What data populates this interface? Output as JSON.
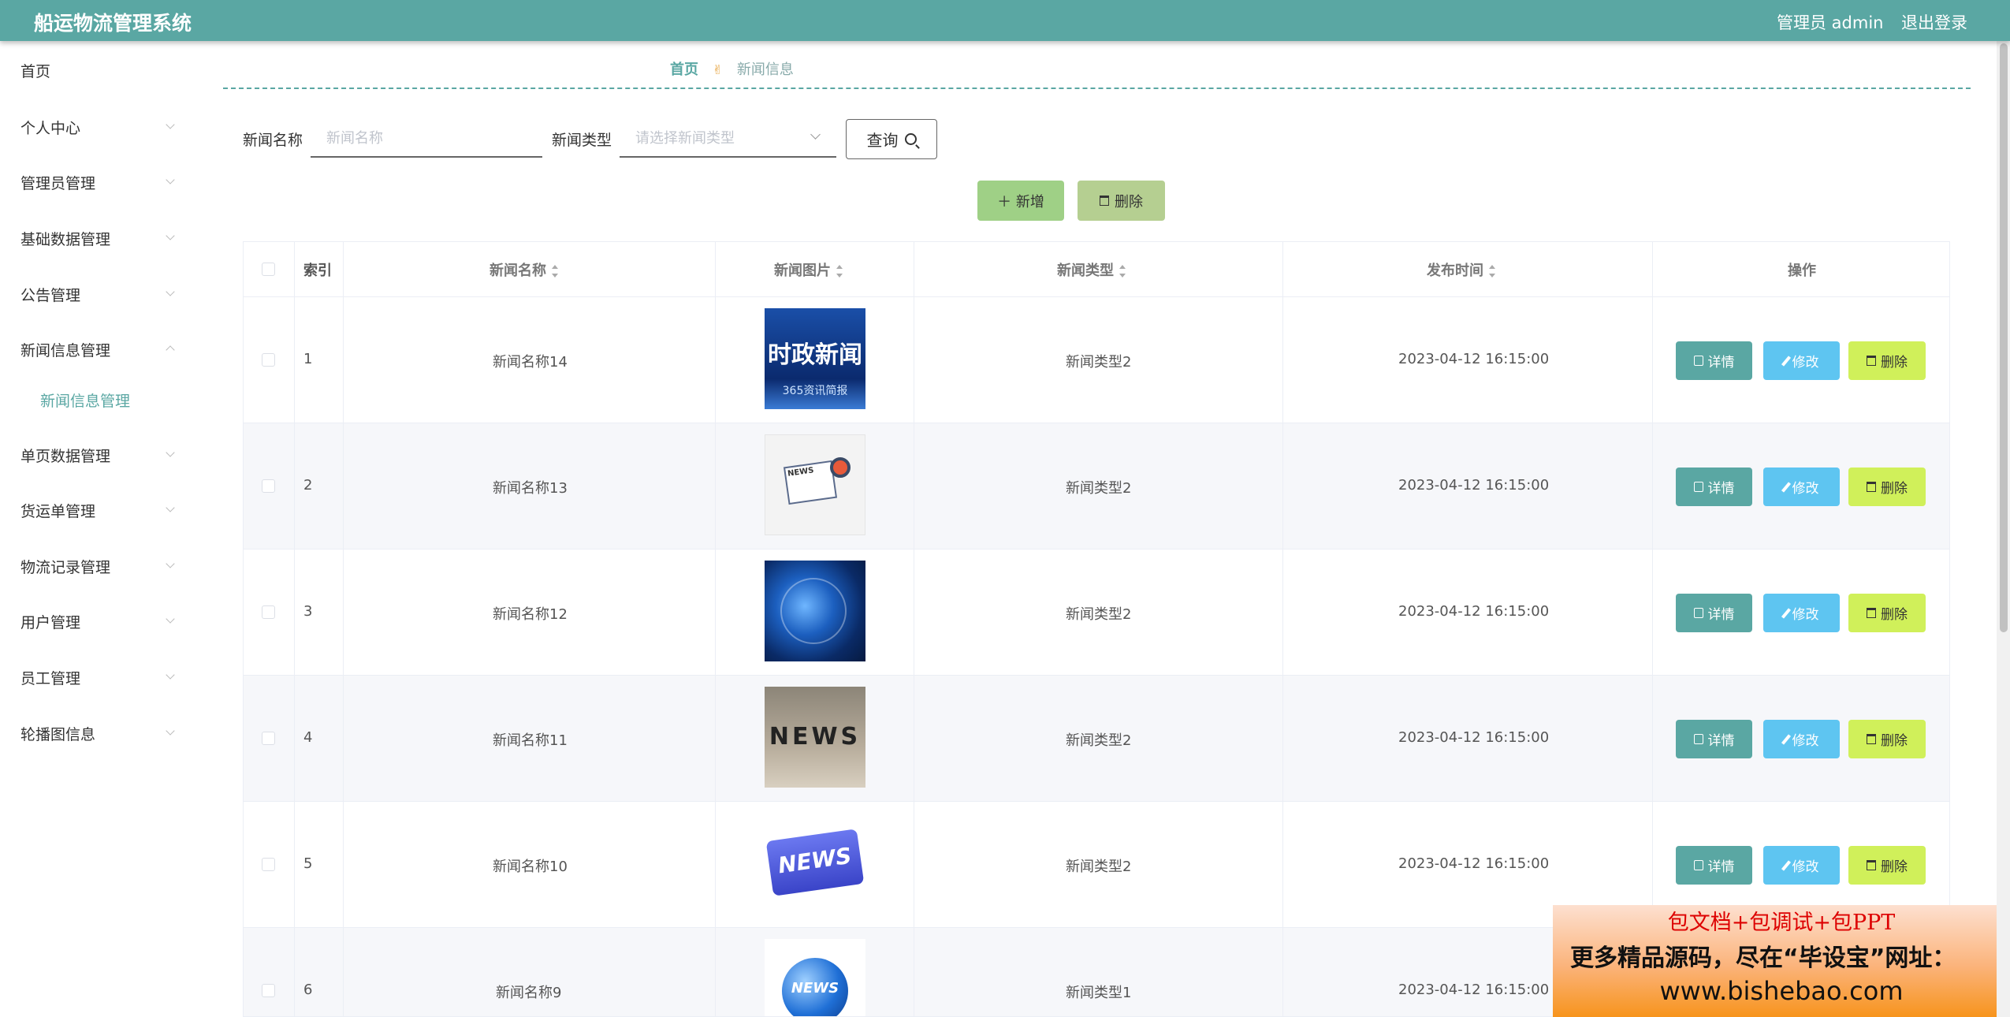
{
  "header": {
    "app_title": "船运物流管理系统",
    "user_label": "管理员 admin",
    "logout_label": "退出登录"
  },
  "sidebar": {
    "items": [
      {
        "label": "首页"
      },
      {
        "label": "个人中心"
      },
      {
        "label": "管理员管理"
      },
      {
        "label": "基础数据管理"
      },
      {
        "label": "公告管理"
      },
      {
        "label": "新闻信息管理"
      },
      {
        "label": "新闻信息管理"
      },
      {
        "label": "单页数据管理"
      },
      {
        "label": "货运单管理"
      },
      {
        "label": "物流记录管理"
      },
      {
        "label": "用户管理"
      },
      {
        "label": "员工管理"
      },
      {
        "label": "轮播图信息"
      }
    ]
  },
  "breadcrumb": {
    "home": "首页",
    "current": "新闻信息"
  },
  "filters": {
    "name_label": "新闻名称",
    "name_placeholder": "新闻名称",
    "type_label": "新闻类型",
    "type_placeholder": "请选择新闻类型",
    "query_label": "查询"
  },
  "actions": {
    "add_label": "新增",
    "delete_label": "删除"
  },
  "table": {
    "headers": {
      "index": "索引",
      "name": "新闻名称",
      "image": "新闻图片",
      "type": "新闻类型",
      "time": "发布时间",
      "ops": "操作"
    },
    "row_buttons": {
      "detail": "详情",
      "edit": "修改",
      "delete": "删除"
    },
    "rows": [
      {
        "index": "1",
        "name": "新闻名称14",
        "image_text": "时政新闻",
        "image_sub": "365资讯简报",
        "type": "新闻类型2",
        "time": "2023-04-12 16:15:00"
      },
      {
        "index": "2",
        "name": "新闻名称13",
        "image_text": "NEWS",
        "type": "新闻类型2",
        "time": "2023-04-12 16:15:00"
      },
      {
        "index": "3",
        "name": "新闻名称12",
        "type": "新闻类型2",
        "time": "2023-04-12 16:15:00"
      },
      {
        "index": "4",
        "name": "新闻名称11",
        "image_text": "NEWS",
        "type": "新闻类型2",
        "time": "2023-04-12 16:15:00"
      },
      {
        "index": "5",
        "name": "新闻名称10",
        "image_text": "NEWS",
        "type": "新闻类型2",
        "time": "2023-04-12 16:15:00"
      },
      {
        "index": "6",
        "name": "新闻名称9",
        "image_text": "NEWS",
        "type": "新闻类型1",
        "time": "2023-04-12 16:15:00"
      }
    ]
  },
  "promo": {
    "line1": "包文档+包调试+包PPT",
    "line2": "更多精品源码，尽在“毕设宝”网址：",
    "line3": "www.bishebao.com"
  },
  "colors": {
    "primary": "#5aa7a3",
    "edit": "#5ec5f1",
    "delete": "#d0f05a"
  }
}
